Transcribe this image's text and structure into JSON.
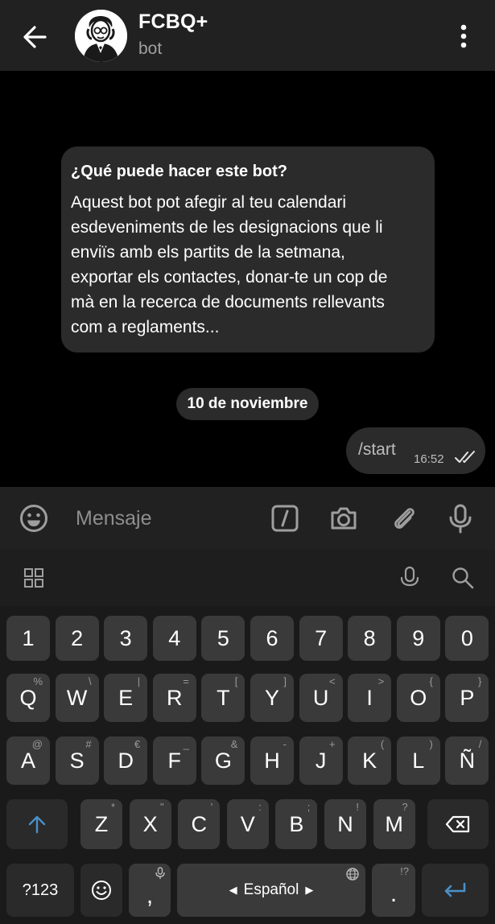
{
  "header": {
    "title": "FCBQ+",
    "subtitle": "bot"
  },
  "chat": {
    "info_title": "¿Qué puede hacer este bot?",
    "info_body_lines": [
      "Aquest bot pot afegir al teu calendari",
      "esdeveniments de les designacions que li",
      "enviïs amb els partits de la setmana,",
      "exportar els contactes, donar-te un cop de",
      "mà en la recerca de documents rellevants",
      "com a reglaments..."
    ],
    "date_label": "10 de noviembre",
    "outgoing": {
      "text": "/start",
      "time": "16:52"
    }
  },
  "input": {
    "placeholder": "Mensaje"
  },
  "keyboard": {
    "row_numbers": [
      "1",
      "2",
      "3",
      "4",
      "5",
      "6",
      "7",
      "8",
      "9",
      "0"
    ],
    "row_q": [
      {
        "k": "Q",
        "h": "%"
      },
      {
        "k": "W",
        "h": "\\"
      },
      {
        "k": "E",
        "h": "|"
      },
      {
        "k": "R",
        "h": "="
      },
      {
        "k": "T",
        "h": "["
      },
      {
        "k": "Y",
        "h": "]"
      },
      {
        "k": "U",
        "h": "<"
      },
      {
        "k": "I",
        "h": ">"
      },
      {
        "k": "O",
        "h": "{"
      },
      {
        "k": "P",
        "h": "}"
      }
    ],
    "row_a": [
      {
        "k": "A",
        "h": "@"
      },
      {
        "k": "S",
        "h": "#"
      },
      {
        "k": "D",
        "h": "€"
      },
      {
        "k": "F",
        "h": "_"
      },
      {
        "k": "G",
        "h": "&"
      },
      {
        "k": "H",
        "h": "-"
      },
      {
        "k": "J",
        "h": "+"
      },
      {
        "k": "K",
        "h": "("
      },
      {
        "k": "L",
        "h": ")"
      },
      {
        "k": "Ñ",
        "h": "/"
      }
    ],
    "row_z": [
      {
        "k": "Z",
        "h": "*"
      },
      {
        "k": "X",
        "h": "\""
      },
      {
        "k": "C",
        "h": "'"
      },
      {
        "k": "V",
        "h": ":"
      },
      {
        "k": "B",
        "h": ";"
      },
      {
        "k": "N",
        "h": "!"
      },
      {
        "k": "M",
        "h": "?"
      }
    ],
    "symbols_label": "?123",
    "comma": ",",
    "space_label": "Español",
    "period": ".",
    "period_hint": "!?"
  },
  "colors": {
    "accent_blue": "#4a90c8",
    "header_bg": "#212121",
    "bubble_bg": "#2b2b2b"
  }
}
